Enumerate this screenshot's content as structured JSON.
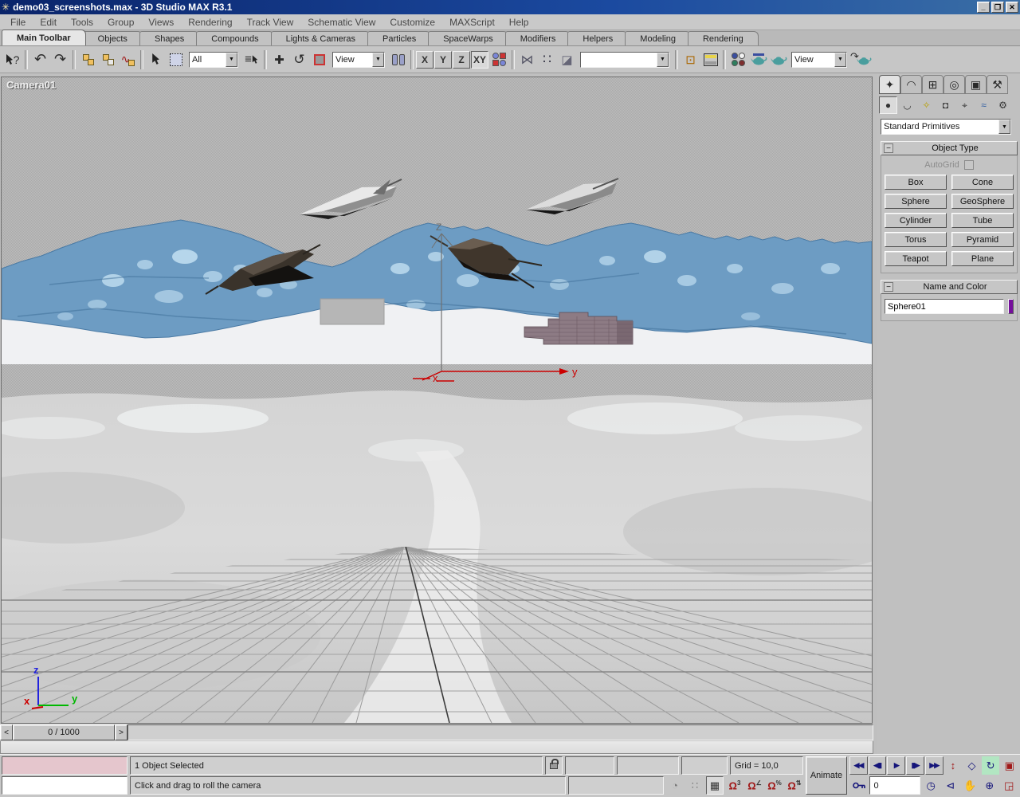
{
  "window": {
    "icon": "✳",
    "title": "demo03_screenshots.max - 3D Studio MAX R3.1",
    "minimize": "_",
    "restore": "❐",
    "close": "✕"
  },
  "menu": [
    "File",
    "Edit",
    "Tools",
    "Group",
    "Views",
    "Rendering",
    "Track View",
    "Schematic View",
    "Customize",
    "MAXScript",
    "Help"
  ],
  "tabs": [
    "Main Toolbar",
    "Objects",
    "Shapes",
    "Compounds",
    "Lights & Cameras",
    "Particles",
    "Helpers",
    "SpaceWarps",
    "Modifiers",
    "Modeling",
    "Rendering"
  ],
  "toolbar": {
    "filter_dropdown": "All",
    "coord_dropdown": "View",
    "selection_set_dropdown": "",
    "render_type_dropdown": "View",
    "axis_x": "X",
    "axis_y": "Y",
    "axis_z": "Z",
    "axis_xy": "XY",
    "icons": {
      "help": "?",
      "undo": "↶",
      "redo": "↷",
      "bind_wave": "∿",
      "select_by_name": "≡",
      "move": "✚",
      "rotate": "↺",
      "mirror": "⋈",
      "array": "∷",
      "align": "◪",
      "align_normals": "⊡",
      "render_last_arrow": "↷",
      "dd_arrow": "▼"
    }
  },
  "viewport": {
    "label": "Camera01",
    "gizmo_x": "x",
    "gizmo_y": "y",
    "gizmo_z": "Z",
    "axis_x": "x",
    "axis_y": "y",
    "axis_z": "z"
  },
  "timeline": {
    "prev": "<",
    "value": "0 / 1000",
    "next": ">"
  },
  "status": {
    "selection": "1 Object Selected",
    "prompt": "Click and drag to roll the camera",
    "grid": "Grid = 10,0",
    "animate": "Animate",
    "frame": "0",
    "transport": {
      "start": "◀◀",
      "prev": "◀▮",
      "play": "▶",
      "next": "▮▶",
      "end": "▶▶"
    },
    "nav": {
      "dolly": "↕",
      "fov_diamond": "◇",
      "roll": "↻",
      "zoom_extents": "▣",
      "time_config": "◷",
      "fov": "⊲",
      "pan": "✋",
      "orbit": "⊕",
      "minmax": "◲"
    },
    "snaps": {
      "degradation": "◔",
      "snap_dots": "∷",
      "snap_cube": "▦",
      "magnet": "Ω",
      "sup3": "3",
      "sup_angle": "∠",
      "sup_pct": "%",
      "sup_spin": "⇅"
    }
  },
  "panel": {
    "tabs": {
      "create": "✦",
      "modify": "◠",
      "hierarchy": "⊞",
      "motion": "◎",
      "display": "▣",
      "utilities": "⚒"
    },
    "categories": {
      "geometry": "●",
      "shapes": "◡",
      "lights": "✧",
      "cameras": "◘",
      "helpers": "⌖",
      "spacewarps": "≈",
      "systems": "⚙"
    },
    "category_dropdown": "Standard Primitives",
    "object_type": {
      "collapse": "−",
      "title": "Object Type",
      "autogrid": "AutoGrid",
      "buttons": [
        "Box",
        "Cone",
        "Sphere",
        "GeoSphere",
        "Cylinder",
        "Tube",
        "Torus",
        "Pyramid",
        "Teapot",
        "Plane"
      ]
    },
    "name_color": {
      "collapse": "−",
      "title": "Name and Color",
      "name": "Sphere01",
      "color": "#750f9c"
    }
  }
}
